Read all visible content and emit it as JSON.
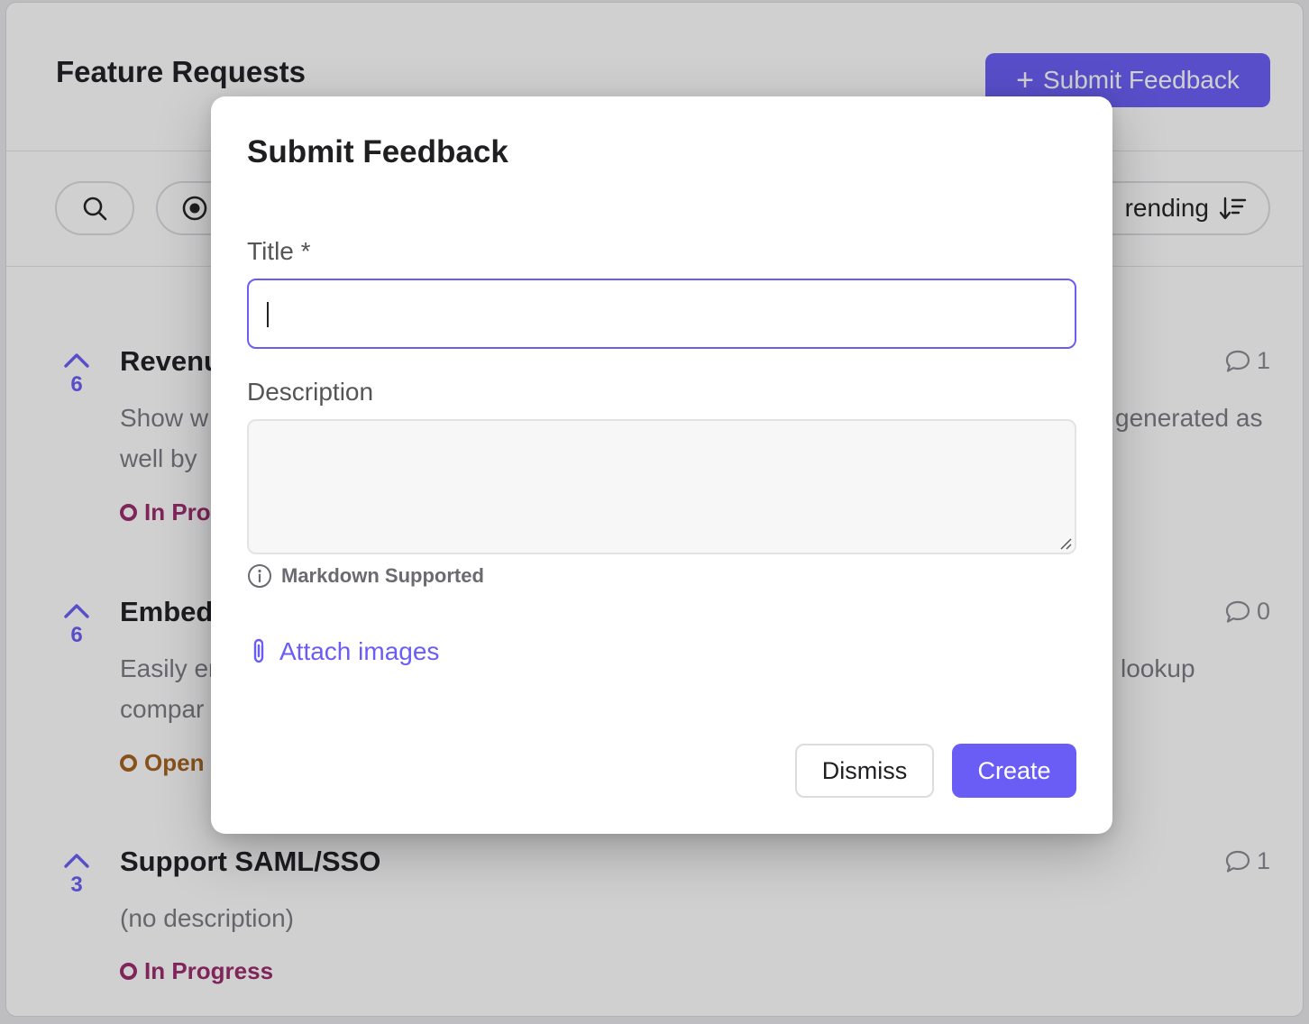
{
  "colors": {
    "accent": "#6a5df5",
    "status_in_progress": "#9c2a6b",
    "status_open": "#a4621b"
  },
  "page": {
    "title": "Feature Requests",
    "submit_button": {
      "icon": "plus-icon",
      "label": "Submit Feedback"
    }
  },
  "toolbar": {
    "search_icon": "search-icon",
    "status_icon": "radio-target-icon",
    "sort_label": "rending",
    "sort_icon": "sort-descending-icon"
  },
  "requests": [
    {
      "votes": "6",
      "title": "Revenu",
      "desc_left_1": "Show w",
      "desc_left_2": "well by",
      "desc_right": "generated as",
      "status": "In Prog",
      "comments": "1"
    },
    {
      "votes": "6",
      "title": "Embed",
      "desc_left_1": "Easily er",
      "desc_left_2": "compar",
      "desc_right": "lookup",
      "status": "Open",
      "comments": "0"
    },
    {
      "votes": "3",
      "title": "Support SAML/SSO",
      "desc_left_1": "(no description)",
      "status": "In Progress",
      "comments": "1"
    }
  ],
  "modal": {
    "title": "Submit Feedback",
    "title_label": "Title *",
    "title_value": "",
    "description_label": "Description",
    "description_value": "",
    "markdown_note": "Markdown Supported",
    "attach_label": "Attach images",
    "dismiss_label": "Dismiss",
    "create_label": "Create"
  }
}
